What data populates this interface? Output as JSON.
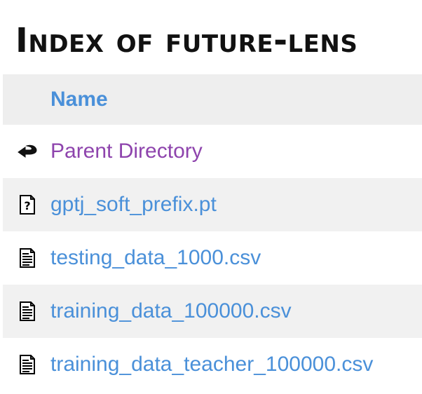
{
  "page": {
    "title": "Index of future-lens"
  },
  "table": {
    "header": {
      "name_label": "Name"
    }
  },
  "entries": [
    {
      "name": "Parent Directory",
      "icon": "back-icon",
      "visited": true
    },
    {
      "name": "gptj_soft_prefix.pt",
      "icon": "unknown-file-icon",
      "visited": false
    },
    {
      "name": "testing_data_1000.csv",
      "icon": "text-file-icon",
      "visited": false
    },
    {
      "name": "training_data_100000.csv",
      "icon": "text-file-icon",
      "visited": false
    },
    {
      "name": "training_data_teacher_100000.csv",
      "icon": "text-file-icon",
      "visited": false
    }
  ],
  "colors": {
    "link": "#4a90d9",
    "visited": "#8e44ad",
    "row_shade": "#f1f1f1"
  }
}
